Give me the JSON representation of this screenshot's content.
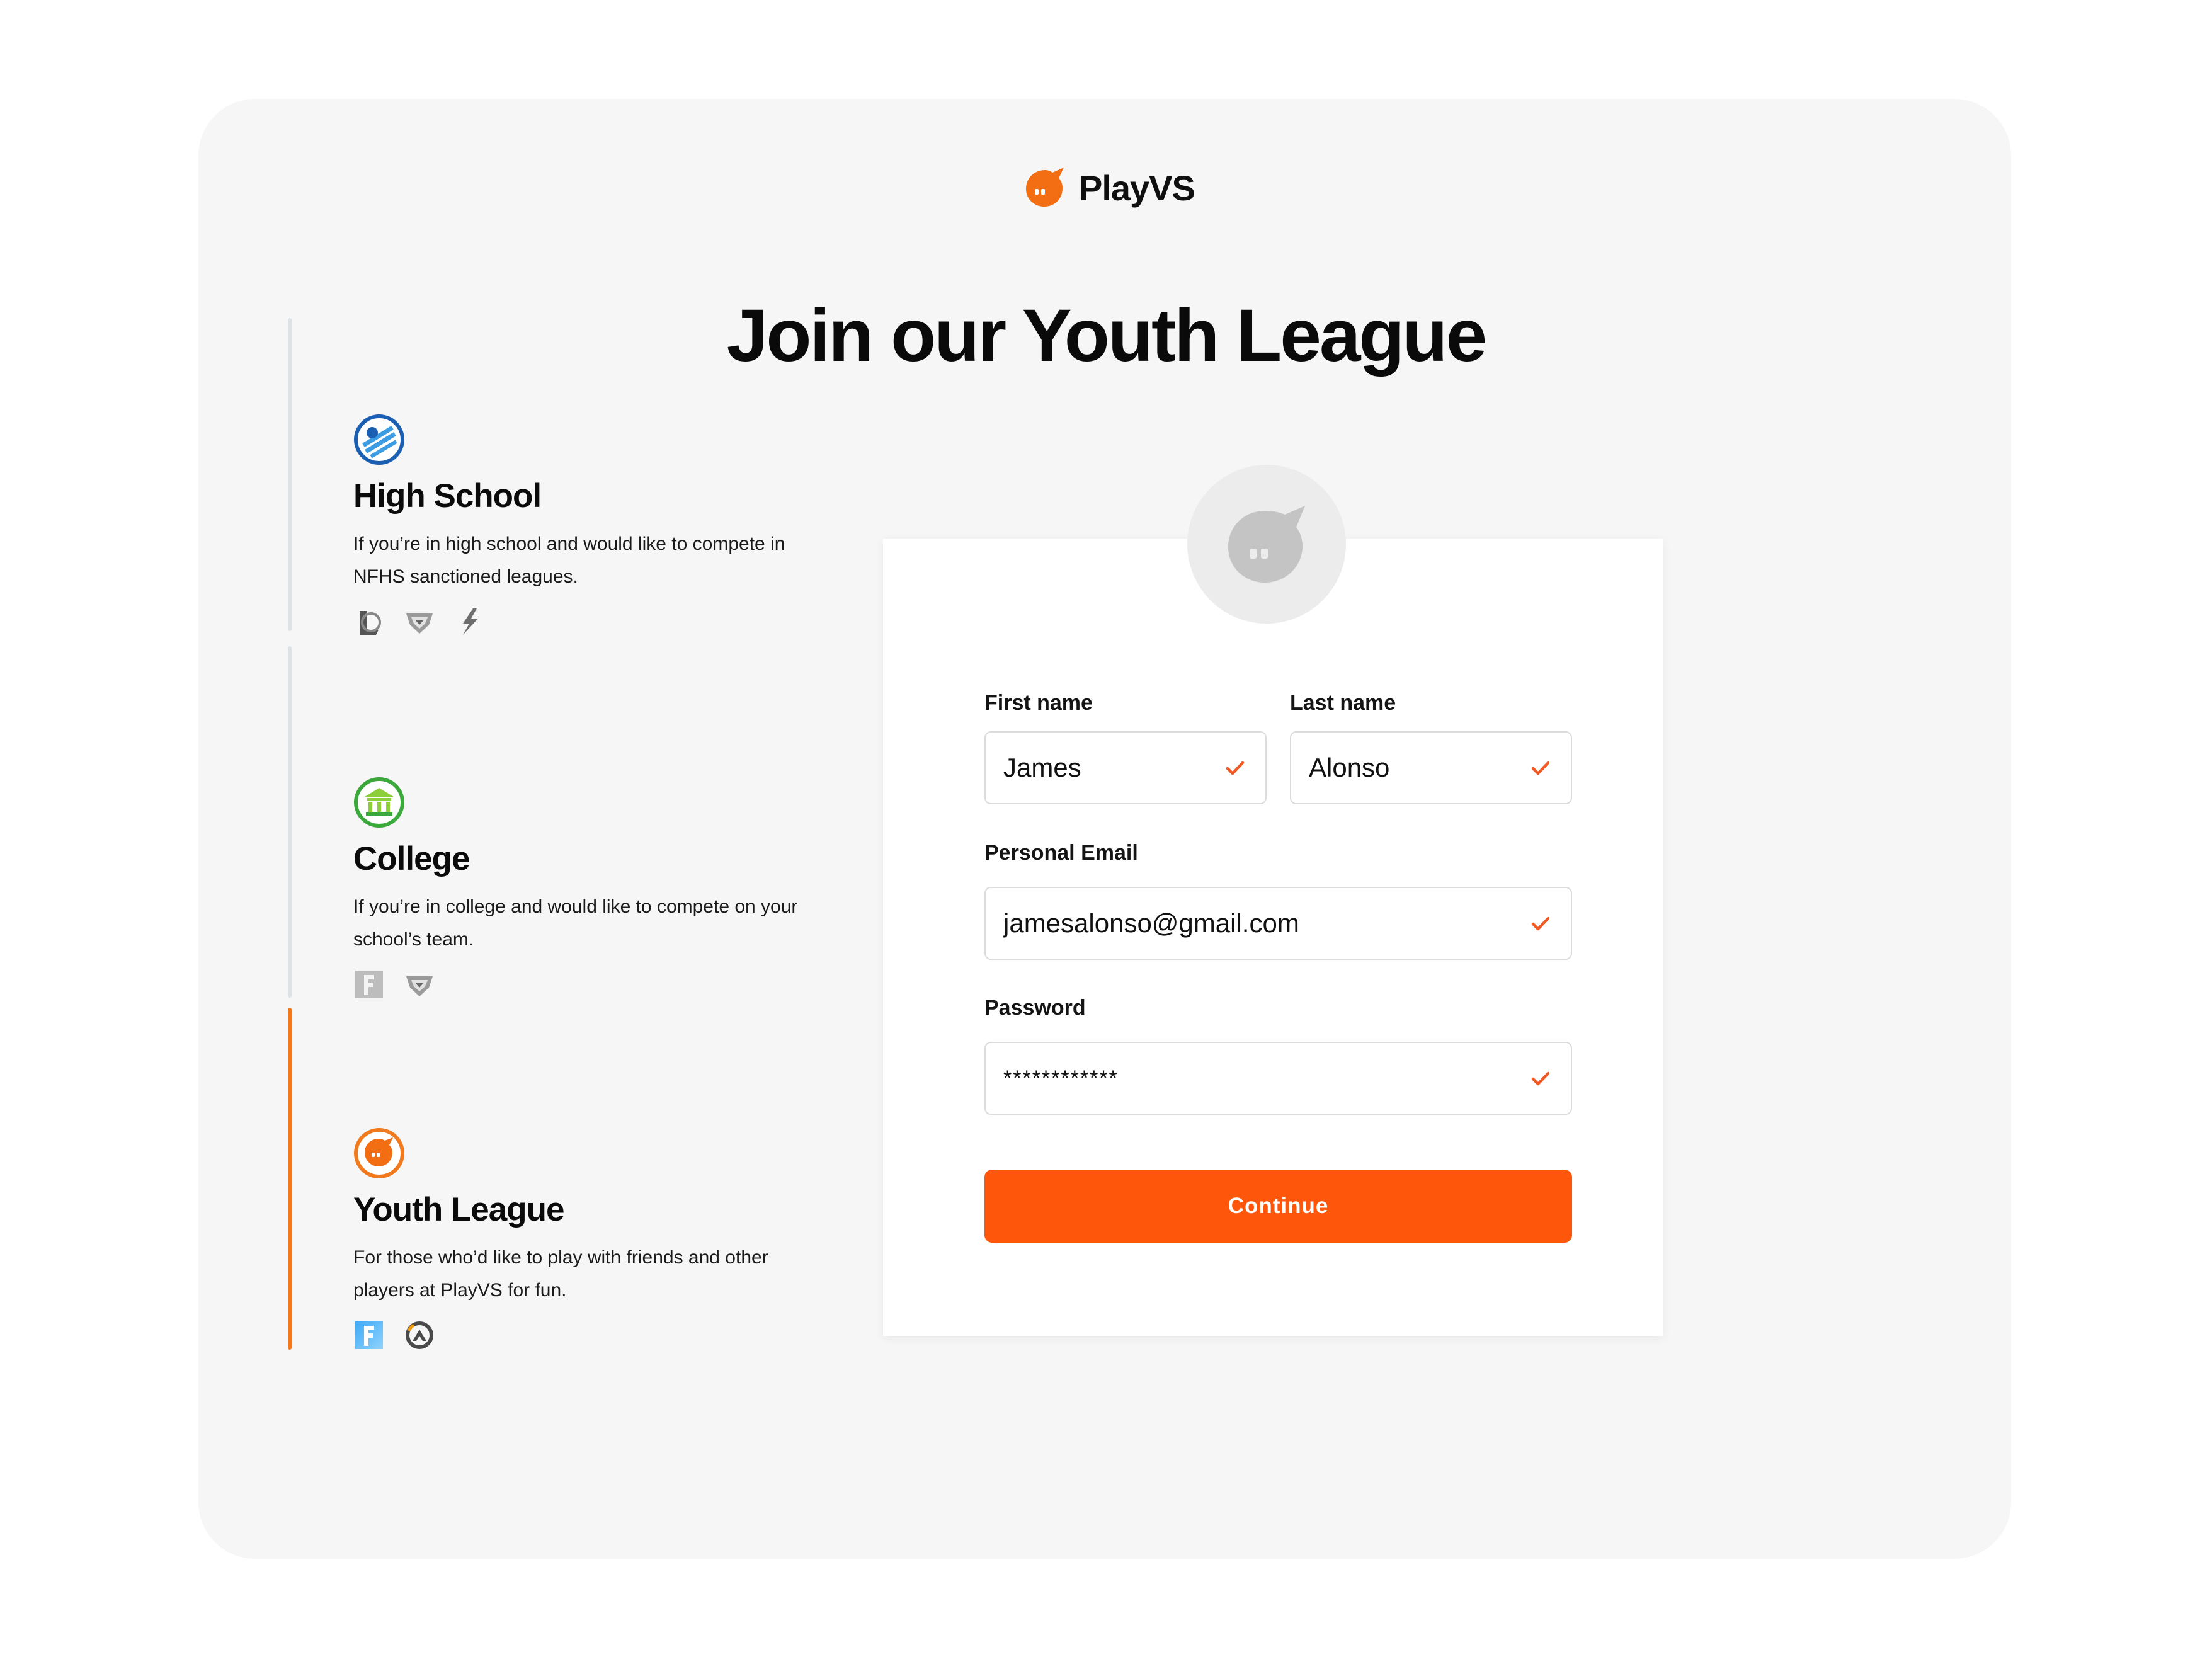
{
  "brand": {
    "name": "PlayVS",
    "accent": "#fe560b",
    "accent_orange": "#f07a1d"
  },
  "page": {
    "title": "Join our Youth League"
  },
  "leagues": [
    {
      "title": "High School",
      "description": "If you’re in high school and would like to compete in NFHS sanctioned leagues.",
      "icon": "high-school-icon",
      "games": [
        "league-of-legends-icon",
        "rocket-league-icon",
        "smite-icon"
      ],
      "active": false
    },
    {
      "title": "College",
      "description": "If you’re in college and would like to compete on your school’s team.",
      "icon": "college-icon",
      "games": [
        "fortnite-icon",
        "rocket-league-icon"
      ],
      "active": false
    },
    {
      "title": "Youth League",
      "description": "For those who’d like to play with friends and other players at PlayVS for fun.",
      "icon": "youth-league-icon",
      "games": [
        "fortnite-icon",
        "overwatch-icon"
      ],
      "active": true
    }
  ],
  "form": {
    "first_name": {
      "label": "First name",
      "value": "James",
      "valid": true
    },
    "last_name": {
      "label": "Last name",
      "value": "Alonso",
      "valid": true
    },
    "email": {
      "label": "Personal Email",
      "value": "jamesalonso@gmail.com",
      "valid": true
    },
    "password": {
      "label": "Password",
      "value": "************",
      "valid": true
    },
    "submit_label": "Continue"
  }
}
